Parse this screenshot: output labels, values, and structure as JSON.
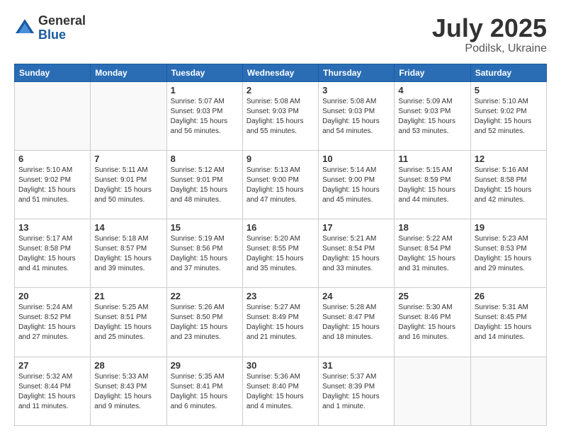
{
  "header": {
    "logo_general": "General",
    "logo_blue": "Blue",
    "month": "July 2025",
    "location": "Podilsk, Ukraine"
  },
  "weekdays": [
    "Sunday",
    "Monday",
    "Tuesday",
    "Wednesday",
    "Thursday",
    "Friday",
    "Saturday"
  ],
  "weeks": [
    [
      {
        "day": "",
        "info": ""
      },
      {
        "day": "",
        "info": ""
      },
      {
        "day": "1",
        "info": "Sunrise: 5:07 AM\nSunset: 9:03 PM\nDaylight: 15 hours\nand 56 minutes."
      },
      {
        "day": "2",
        "info": "Sunrise: 5:08 AM\nSunset: 9:03 PM\nDaylight: 15 hours\nand 55 minutes."
      },
      {
        "day": "3",
        "info": "Sunrise: 5:08 AM\nSunset: 9:03 PM\nDaylight: 15 hours\nand 54 minutes."
      },
      {
        "day": "4",
        "info": "Sunrise: 5:09 AM\nSunset: 9:03 PM\nDaylight: 15 hours\nand 53 minutes."
      },
      {
        "day": "5",
        "info": "Sunrise: 5:10 AM\nSunset: 9:02 PM\nDaylight: 15 hours\nand 52 minutes."
      }
    ],
    [
      {
        "day": "6",
        "info": "Sunrise: 5:10 AM\nSunset: 9:02 PM\nDaylight: 15 hours\nand 51 minutes."
      },
      {
        "day": "7",
        "info": "Sunrise: 5:11 AM\nSunset: 9:01 PM\nDaylight: 15 hours\nand 50 minutes."
      },
      {
        "day": "8",
        "info": "Sunrise: 5:12 AM\nSunset: 9:01 PM\nDaylight: 15 hours\nand 48 minutes."
      },
      {
        "day": "9",
        "info": "Sunrise: 5:13 AM\nSunset: 9:00 PM\nDaylight: 15 hours\nand 47 minutes."
      },
      {
        "day": "10",
        "info": "Sunrise: 5:14 AM\nSunset: 9:00 PM\nDaylight: 15 hours\nand 45 minutes."
      },
      {
        "day": "11",
        "info": "Sunrise: 5:15 AM\nSunset: 8:59 PM\nDaylight: 15 hours\nand 44 minutes."
      },
      {
        "day": "12",
        "info": "Sunrise: 5:16 AM\nSunset: 8:58 PM\nDaylight: 15 hours\nand 42 minutes."
      }
    ],
    [
      {
        "day": "13",
        "info": "Sunrise: 5:17 AM\nSunset: 8:58 PM\nDaylight: 15 hours\nand 41 minutes."
      },
      {
        "day": "14",
        "info": "Sunrise: 5:18 AM\nSunset: 8:57 PM\nDaylight: 15 hours\nand 39 minutes."
      },
      {
        "day": "15",
        "info": "Sunrise: 5:19 AM\nSunset: 8:56 PM\nDaylight: 15 hours\nand 37 minutes."
      },
      {
        "day": "16",
        "info": "Sunrise: 5:20 AM\nSunset: 8:55 PM\nDaylight: 15 hours\nand 35 minutes."
      },
      {
        "day": "17",
        "info": "Sunrise: 5:21 AM\nSunset: 8:54 PM\nDaylight: 15 hours\nand 33 minutes."
      },
      {
        "day": "18",
        "info": "Sunrise: 5:22 AM\nSunset: 8:54 PM\nDaylight: 15 hours\nand 31 minutes."
      },
      {
        "day": "19",
        "info": "Sunrise: 5:23 AM\nSunset: 8:53 PM\nDaylight: 15 hours\nand 29 minutes."
      }
    ],
    [
      {
        "day": "20",
        "info": "Sunrise: 5:24 AM\nSunset: 8:52 PM\nDaylight: 15 hours\nand 27 minutes."
      },
      {
        "day": "21",
        "info": "Sunrise: 5:25 AM\nSunset: 8:51 PM\nDaylight: 15 hours\nand 25 minutes."
      },
      {
        "day": "22",
        "info": "Sunrise: 5:26 AM\nSunset: 8:50 PM\nDaylight: 15 hours\nand 23 minutes."
      },
      {
        "day": "23",
        "info": "Sunrise: 5:27 AM\nSunset: 8:49 PM\nDaylight: 15 hours\nand 21 minutes."
      },
      {
        "day": "24",
        "info": "Sunrise: 5:28 AM\nSunset: 8:47 PM\nDaylight: 15 hours\nand 18 minutes."
      },
      {
        "day": "25",
        "info": "Sunrise: 5:30 AM\nSunset: 8:46 PM\nDaylight: 15 hours\nand 16 minutes."
      },
      {
        "day": "26",
        "info": "Sunrise: 5:31 AM\nSunset: 8:45 PM\nDaylight: 15 hours\nand 14 minutes."
      }
    ],
    [
      {
        "day": "27",
        "info": "Sunrise: 5:32 AM\nSunset: 8:44 PM\nDaylight: 15 hours\nand 11 minutes."
      },
      {
        "day": "28",
        "info": "Sunrise: 5:33 AM\nSunset: 8:43 PM\nDaylight: 15 hours\nand 9 minutes."
      },
      {
        "day": "29",
        "info": "Sunrise: 5:35 AM\nSunset: 8:41 PM\nDaylight: 15 hours\nand 6 minutes."
      },
      {
        "day": "30",
        "info": "Sunrise: 5:36 AM\nSunset: 8:40 PM\nDaylight: 15 hours\nand 4 minutes."
      },
      {
        "day": "31",
        "info": "Sunrise: 5:37 AM\nSunset: 8:39 PM\nDaylight: 15 hours\nand 1 minute."
      },
      {
        "day": "",
        "info": ""
      },
      {
        "day": "",
        "info": ""
      }
    ]
  ]
}
